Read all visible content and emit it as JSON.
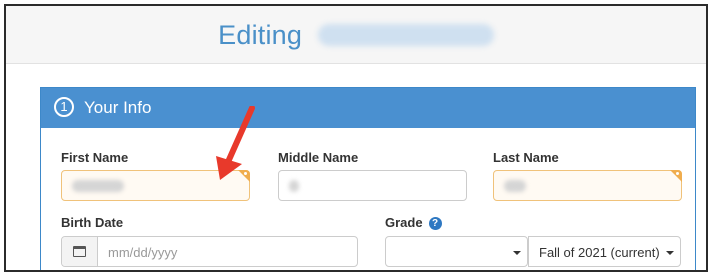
{
  "header": {
    "title_prefix": "Editing"
  },
  "panel": {
    "step_number": "1",
    "title": "Your Info"
  },
  "fields": {
    "first_name_label": "First Name",
    "middle_name_label": "Middle Name",
    "last_name_label": "Last Name",
    "birth_date_label": "Birth Date",
    "birth_date_placeholder": "mm/dd/yyyy",
    "grade_label": "Grade",
    "grade_help_glyph": "?",
    "term_value": "Fall of 2021 (current)"
  },
  "colors": {
    "accent": "#4a90d0",
    "title": "#4a90c8",
    "required_corner": "#f0ad4e",
    "annotation_arrow": "#e8392b"
  },
  "icons": [
    "calendar-icon",
    "help-circle-icon",
    "caret-down-icon",
    "red-arrow-annotation"
  ]
}
